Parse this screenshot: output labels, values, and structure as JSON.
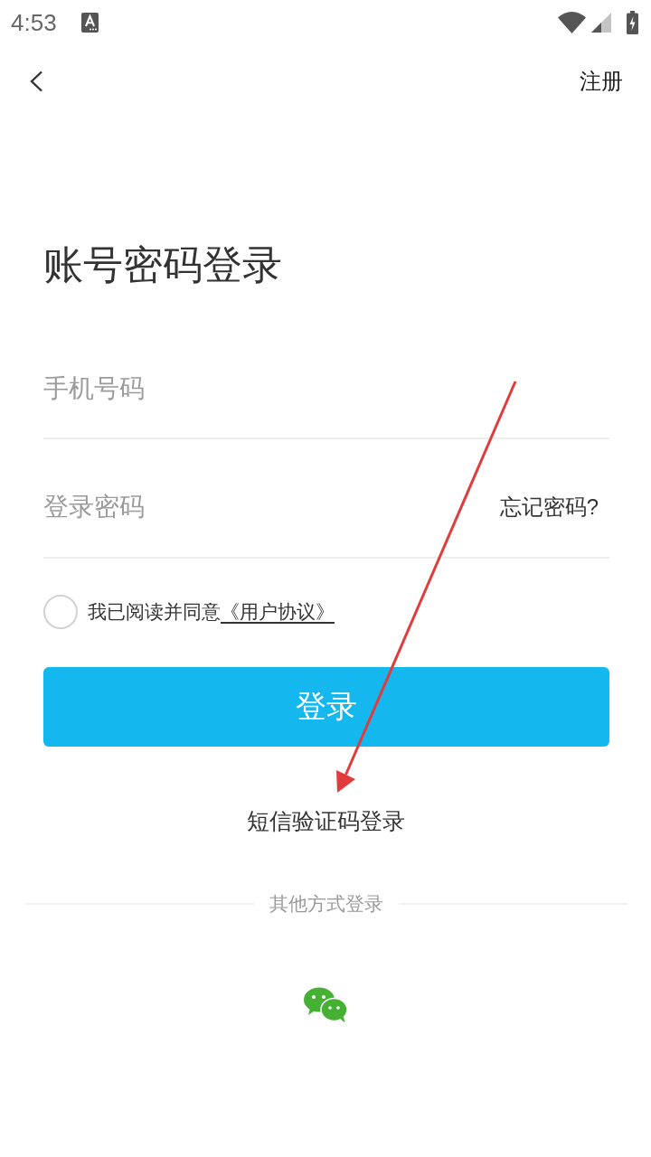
{
  "status_bar": {
    "time": "4:53"
  },
  "header": {
    "register_link": "注册"
  },
  "title": "账号密码登录",
  "phone_field": {
    "placeholder": "手机号码"
  },
  "password_field": {
    "placeholder": "登录密码",
    "forgot_link": "忘记密码?"
  },
  "agreement": {
    "checked": false,
    "text": "我已阅读并同意",
    "link": "《用户协议》"
  },
  "login_button": {
    "label": "登录"
  },
  "sms_login_link": "短信验证码登录",
  "other_login": {
    "label": "其他方式登录"
  }
}
